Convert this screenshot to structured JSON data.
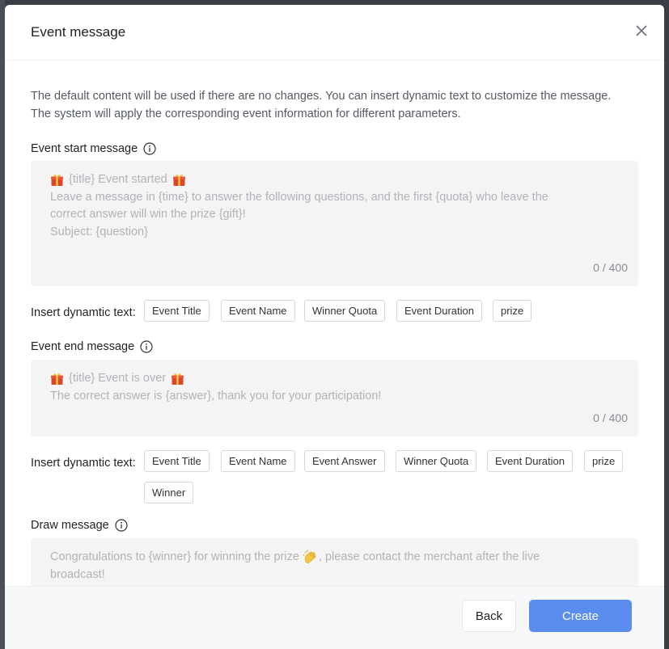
{
  "modal": {
    "title": "Event message",
    "intro": "The default content will be used if there are no changes. You can insert dynamic text to customize the message. The system will apply the corresponding event information for different parameters."
  },
  "start": {
    "label": "Event start message",
    "lines": [
      "{title} Event started",
      "Leave a message in {time} to answer the following questions, and the first {quota} who leave the",
      "correct answer will win the prize {gift}!",
      "Subject: {question}"
    ],
    "counter": "0 / 400",
    "insert_label": "Insert dynamtic text:",
    "chips": [
      "Event Title",
      "Event Name",
      "Winner Quota",
      "Event Duration",
      "prize"
    ]
  },
  "end": {
    "label": "Event end message",
    "lines": [
      "{title} Event is over",
      "The correct answer is {answer}, thank you for your participation!"
    ],
    "counter": "0 / 400",
    "insert_label": "Insert dynamtic text:",
    "chips": [
      "Event Title",
      "Event Name",
      "Event Answer",
      "Winner Quota",
      "Event Duration",
      "prize",
      "Winner"
    ]
  },
  "draw": {
    "label": "Draw message",
    "line1_before": "Congratulations to {winner} for winning the prize ",
    "line1_after": ", please contact the merchant after the live",
    "line2": "broadcast!"
  },
  "footer": {
    "back": "Back",
    "create": "Create"
  },
  "icons": {
    "close": "close-icon",
    "info": "info-circle-icon",
    "gift": "gift-emoji-icon",
    "clap": "clapping-hands-emoji-icon"
  },
  "colors": {
    "primary": "#5b8def",
    "textarea_bg": "#f4f4f5",
    "placeholder": "#b0b3b8"
  }
}
